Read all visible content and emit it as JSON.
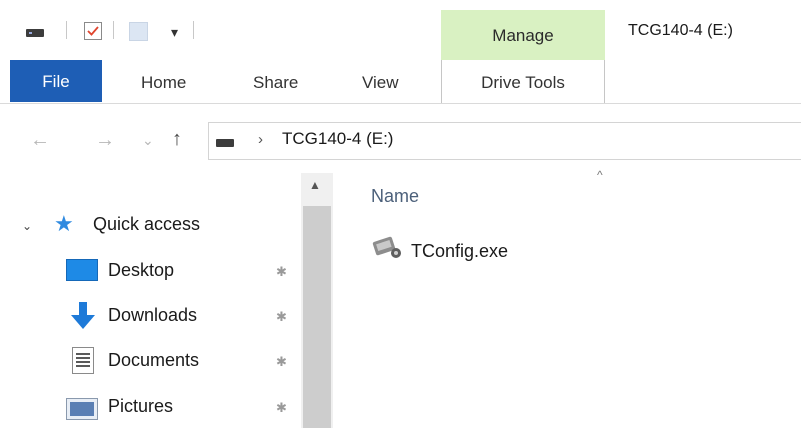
{
  "window": {
    "title": "TCG140-4 (E:)"
  },
  "quick_access_toolbar": {
    "items": [
      "drive-icon",
      "properties-icon",
      "new-folder-icon",
      "customize-dropdown-icon"
    ],
    "dropdown_glyph": "▾"
  },
  "ribbon": {
    "contextual_group": "Manage",
    "tabs": [
      {
        "label": "File",
        "selected": false
      },
      {
        "label": "Home",
        "selected": false
      },
      {
        "label": "Share",
        "selected": false
      },
      {
        "label": "View",
        "selected": false
      },
      {
        "label": "Drive Tools",
        "selected": false
      }
    ],
    "colors": {
      "file_tab": "#1e5eb5",
      "manage_group": "#d9f1c2"
    }
  },
  "navigation": {
    "back_glyph": "←",
    "forward_glyph": "→",
    "recent_glyph": "⌄",
    "up_glyph": "↑",
    "address": {
      "separator": "›",
      "location": "TCG140-4 (E:)"
    }
  },
  "nav_pane": {
    "scroll_up_glyph": "▲",
    "quick_access": {
      "chevron": "⌄",
      "label": "Quick access",
      "items": [
        {
          "label": "Desktop",
          "icon": "desktop-icon",
          "pinned": true
        },
        {
          "label": "Downloads",
          "icon": "downloads-icon",
          "pinned": true
        },
        {
          "label": "Documents",
          "icon": "documents-icon",
          "pinned": true
        },
        {
          "label": "Pictures",
          "icon": "pictures-icon",
          "pinned": true
        }
      ],
      "pin_glyph": "📌"
    }
  },
  "content": {
    "columns": [
      {
        "label": "Name",
        "sort": "ascending"
      }
    ],
    "sort_glyph": "^",
    "files": [
      {
        "name": "TConfig.exe",
        "icon": "application-icon"
      }
    ]
  }
}
